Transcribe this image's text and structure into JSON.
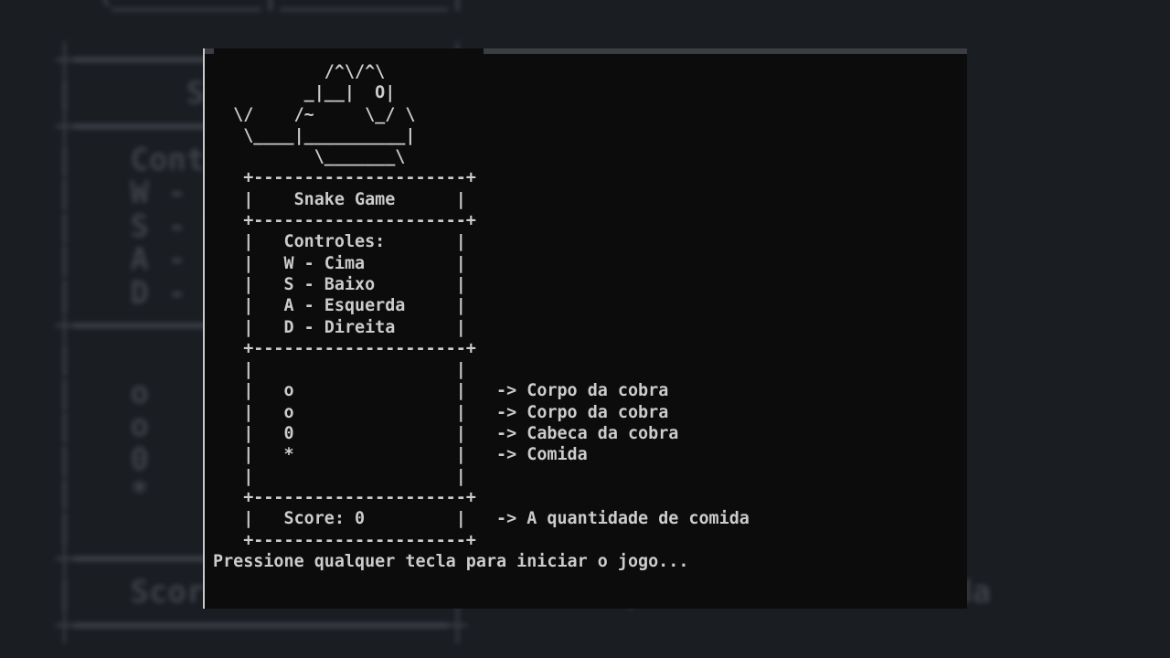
{
  "backdrop": {
    "lines": "   \\________|_________|\n\n ┼━━━━━━━━━━━━━━━━━━━━┼\n |      Snake Game    |\n ┼━━━━━━━━━━━━━━━━━━━━┼\n |   Controles:       |\n |   W - Cima         |\n |   S - Baixo        |\n |   A - Esquerda     |\n |   D - Direita      |\n ┼━━━━━━━━━━━━━━━━━━━━┼\n |                    |\n |   o                |\n |   o                |\n |   0                |\n |   *                |\n |                    |\n ┼━━━━━━━━━━━━━━━━━━━━┼\n |   Score: 0         |   -> A quantidade de comida\n ┼━━━━━━━━━━━━━━━━━━━━┼"
  },
  "terminal": {
    "art": [
      "           /^\\/^\\",
      "         _|__|  O|",
      "  \\/    /~     \\_/ \\",
      "   \\____|__________|",
      "          \\_______\\"
    ],
    "box_border": "+---------------------+",
    "title": "Snake Game",
    "controls_header": "Controles:",
    "controls": [
      "W - Cima",
      "S - Baixo",
      "A - Esquerda",
      "D - Direita"
    ],
    "legend": [
      {
        "symbol": "o",
        "description": "-> Corpo da cobra"
      },
      {
        "symbol": "o",
        "description": "-> Corpo da cobra"
      },
      {
        "symbol": "0",
        "description": "-> Cabeca da cobra"
      },
      {
        "symbol": "*",
        "description": "-> Comida"
      }
    ],
    "score_label": "Score: 0",
    "score_description": "-> A quantidade de comida",
    "prompt": "Pressione qualquer tecla para iniciar o jogo..."
  }
}
